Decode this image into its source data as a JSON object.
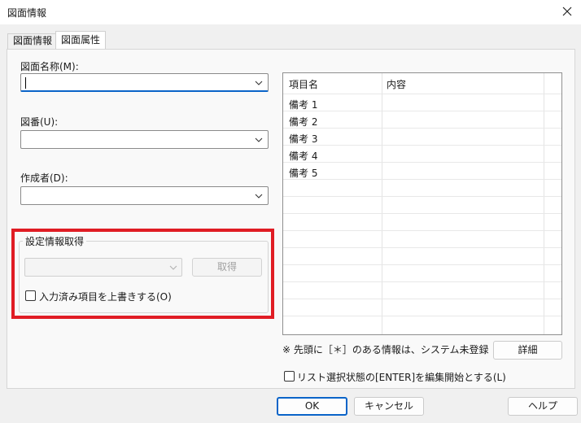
{
  "window": {
    "title": "図面情報"
  },
  "tabs": [
    {
      "label": "図面情報"
    },
    {
      "label": "図面属性"
    }
  ],
  "fields": {
    "name": {
      "label": "図面名称(M):",
      "value": ""
    },
    "number": {
      "label": "図番(U):",
      "value": ""
    },
    "author": {
      "label": "作成者(D):",
      "value": ""
    }
  },
  "settings_group": {
    "title": "設定情報取得",
    "combo_value": "",
    "get_button": "取得",
    "overwrite_checkbox": {
      "label": "入力済み項目を上書きする(O)",
      "checked": false
    }
  },
  "grid": {
    "columns": [
      "項目名",
      "内容"
    ],
    "rows": [
      {
        "name": "備考 1",
        "value": ""
      },
      {
        "name": "備考 2",
        "value": ""
      },
      {
        "name": "備考 3",
        "value": ""
      },
      {
        "name": "備考 4",
        "value": ""
      },
      {
        "name": "備考 5",
        "value": ""
      }
    ]
  },
  "note": "※ 先頭に［＊］のある情報は、システム未登録",
  "detail_button": "詳細",
  "edit_checkbox": {
    "label": "リスト選択状態の[ENTER]を編集開始とする(L)",
    "checked": false
  },
  "footer": {
    "ok": "OK",
    "cancel": "キャンセル",
    "help": "ヘルプ"
  },
  "colors": {
    "highlight": "#e01c24",
    "focus": "#0a64c8"
  }
}
